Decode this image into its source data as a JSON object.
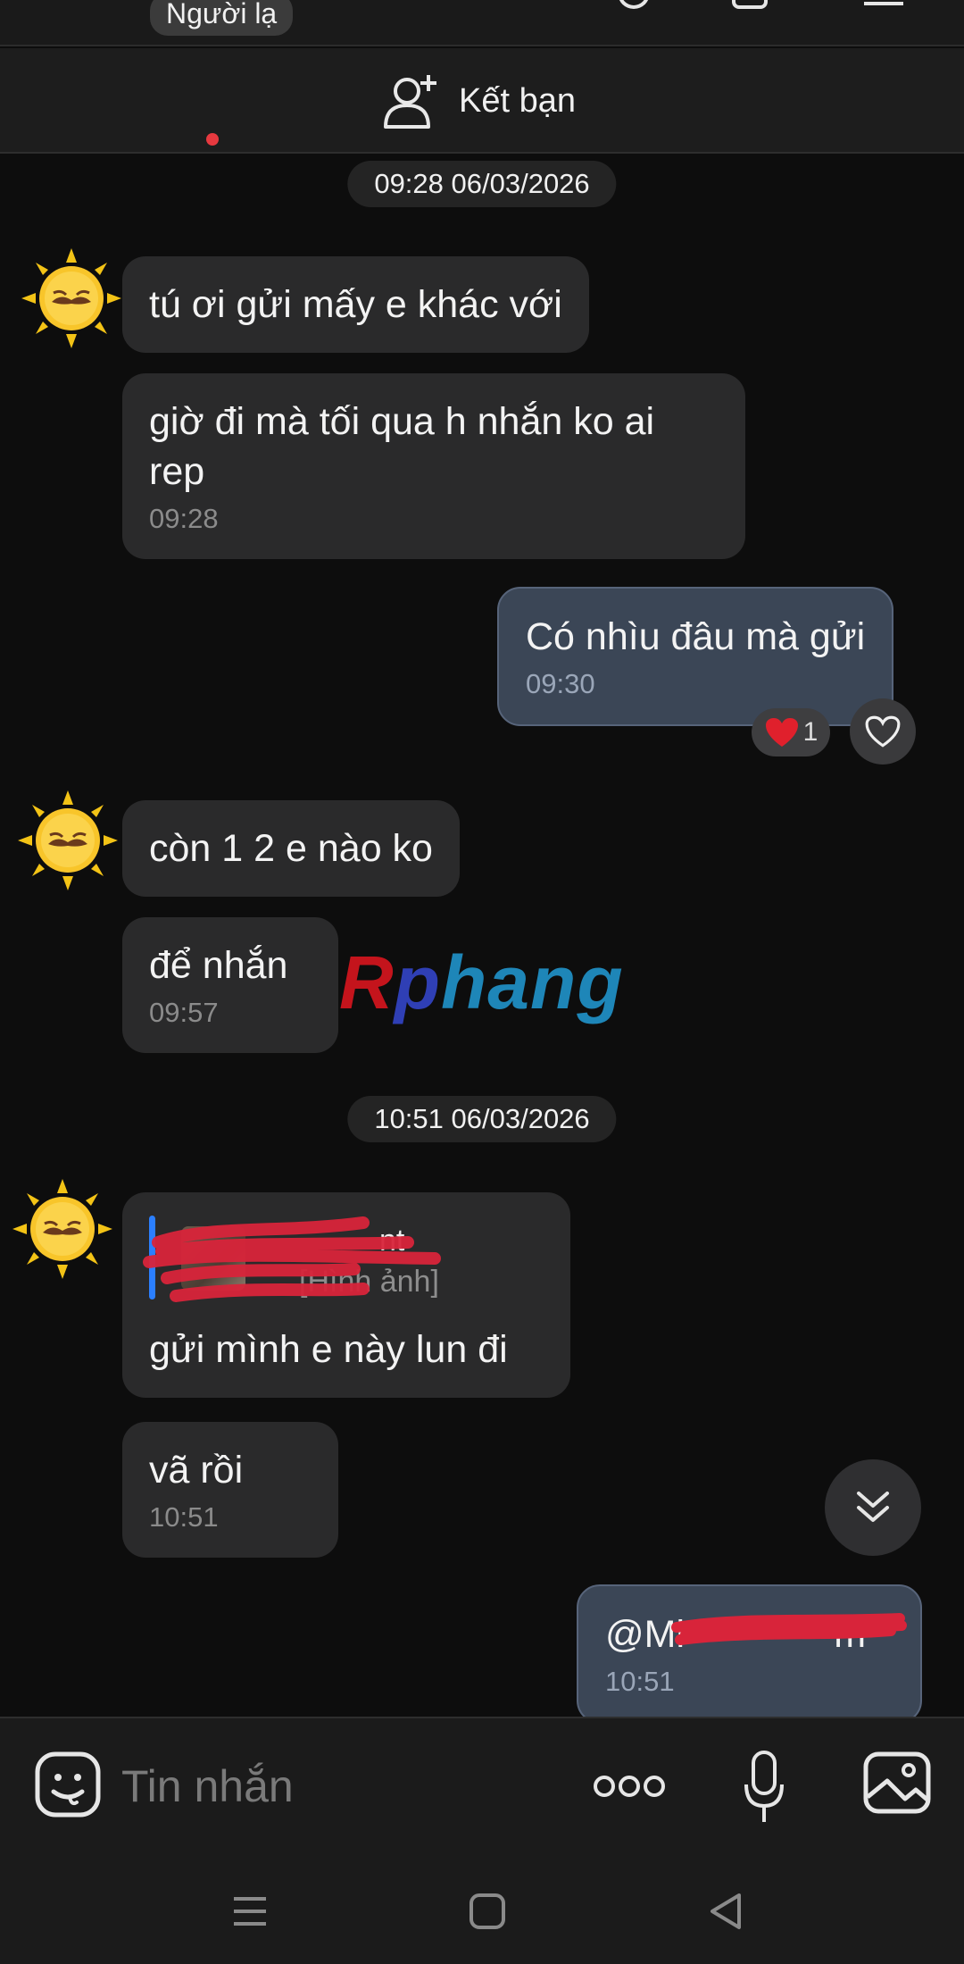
{
  "header": {
    "stranger_badge": "Người lạ",
    "friend_action": "Kết bạn"
  },
  "messages": {
    "date1": "09:28 06/03/2026",
    "m1": {
      "text": "tú ơi gửi mấy e khác với"
    },
    "m2": {
      "text": "giờ đi mà tối qua h nhắn ko ai rep",
      "time": "09:28"
    },
    "m3": {
      "text": "Có nhìu đâu mà gửi",
      "time": "09:30",
      "reaction_count": "1"
    },
    "m4": {
      "text": "còn 1 2 e nào ko"
    },
    "m5": {
      "text": "để nhắn",
      "time": "09:57"
    },
    "watermark": {
      "r": "R",
      "p": "p",
      "rest": "hang"
    },
    "date2": "10:51 06/03/2026",
    "m6": {
      "quote_name": "nt",
      "quote_type": "[Hình ảnh]",
      "text": "gửi mình e này lun đi"
    },
    "m7": {
      "text": "vã rồi",
      "time": "10:51"
    },
    "m8": {
      "text": "@Mi              m",
      "time": "10:51"
    }
  },
  "composer": {
    "placeholder": "Tin nhắn"
  },
  "icons": {
    "add_friend": "add-person-icon",
    "emoji": "emoji-icon",
    "more": "more-icon",
    "mic": "mic-icon",
    "image": "image-icon",
    "scroll_down": "double-chevron-down-icon",
    "react": "heart-outline-icon"
  },
  "colors": {
    "background": "#0d0d0d",
    "incoming_bubble": "#2a2a2b",
    "outgoing_bubble": "#3b4656",
    "quote_bar": "#2b7fff",
    "notification_dot": "#e6393f"
  }
}
